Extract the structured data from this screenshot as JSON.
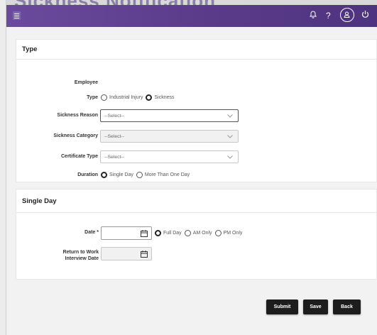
{
  "page": {
    "title": "Sickness Notification"
  },
  "topbar": {
    "menu_icon": "hamburger-icon",
    "bell_icon": "bell-icon",
    "help_glyph": "?",
    "user_icon": "user-circle-icon",
    "power_icon": "power-icon",
    "color": "#5a3b8a"
  },
  "type_section": {
    "title": "Type",
    "employee_label": "Employee",
    "type_label": "Type",
    "type_options": [
      {
        "label": "Industrial Injury",
        "selected": false
      },
      {
        "label": "Sickness",
        "selected": true
      }
    ],
    "sickness_reason": {
      "label": "Sickness Reason",
      "value": "--Select--"
    },
    "sickness_category": {
      "label": "Sickness Category",
      "value": "--Select--"
    },
    "certificate_type": {
      "label": "Certificate Type",
      "value": "--Select--"
    },
    "duration_label": "Duration",
    "duration_options": [
      {
        "label": "Single Day",
        "selected": true
      },
      {
        "label": "More Than One Day",
        "selected": false
      }
    ]
  },
  "single_day_section": {
    "title": "Single Day",
    "date_label": "Date *",
    "day_options": [
      {
        "label": "Full Day",
        "selected": true
      },
      {
        "label": "AM Only",
        "selected": false
      },
      {
        "label": "PM Only",
        "selected": false
      }
    ],
    "rtw_label_line1": "Return to Work",
    "rtw_label_line2": "Interview Date"
  },
  "actions": {
    "submit": "Submit",
    "save": "Save",
    "back": "Back"
  }
}
